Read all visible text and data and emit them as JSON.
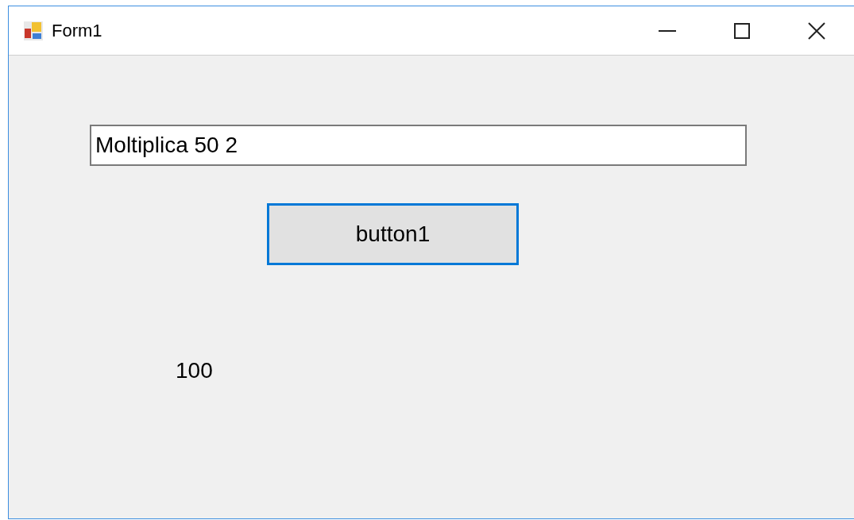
{
  "window": {
    "title": "Form1"
  },
  "textbox": {
    "value": "Moltiplica 50 2"
  },
  "button": {
    "label": "button1",
    "focused": true
  },
  "label": {
    "text": "100"
  }
}
